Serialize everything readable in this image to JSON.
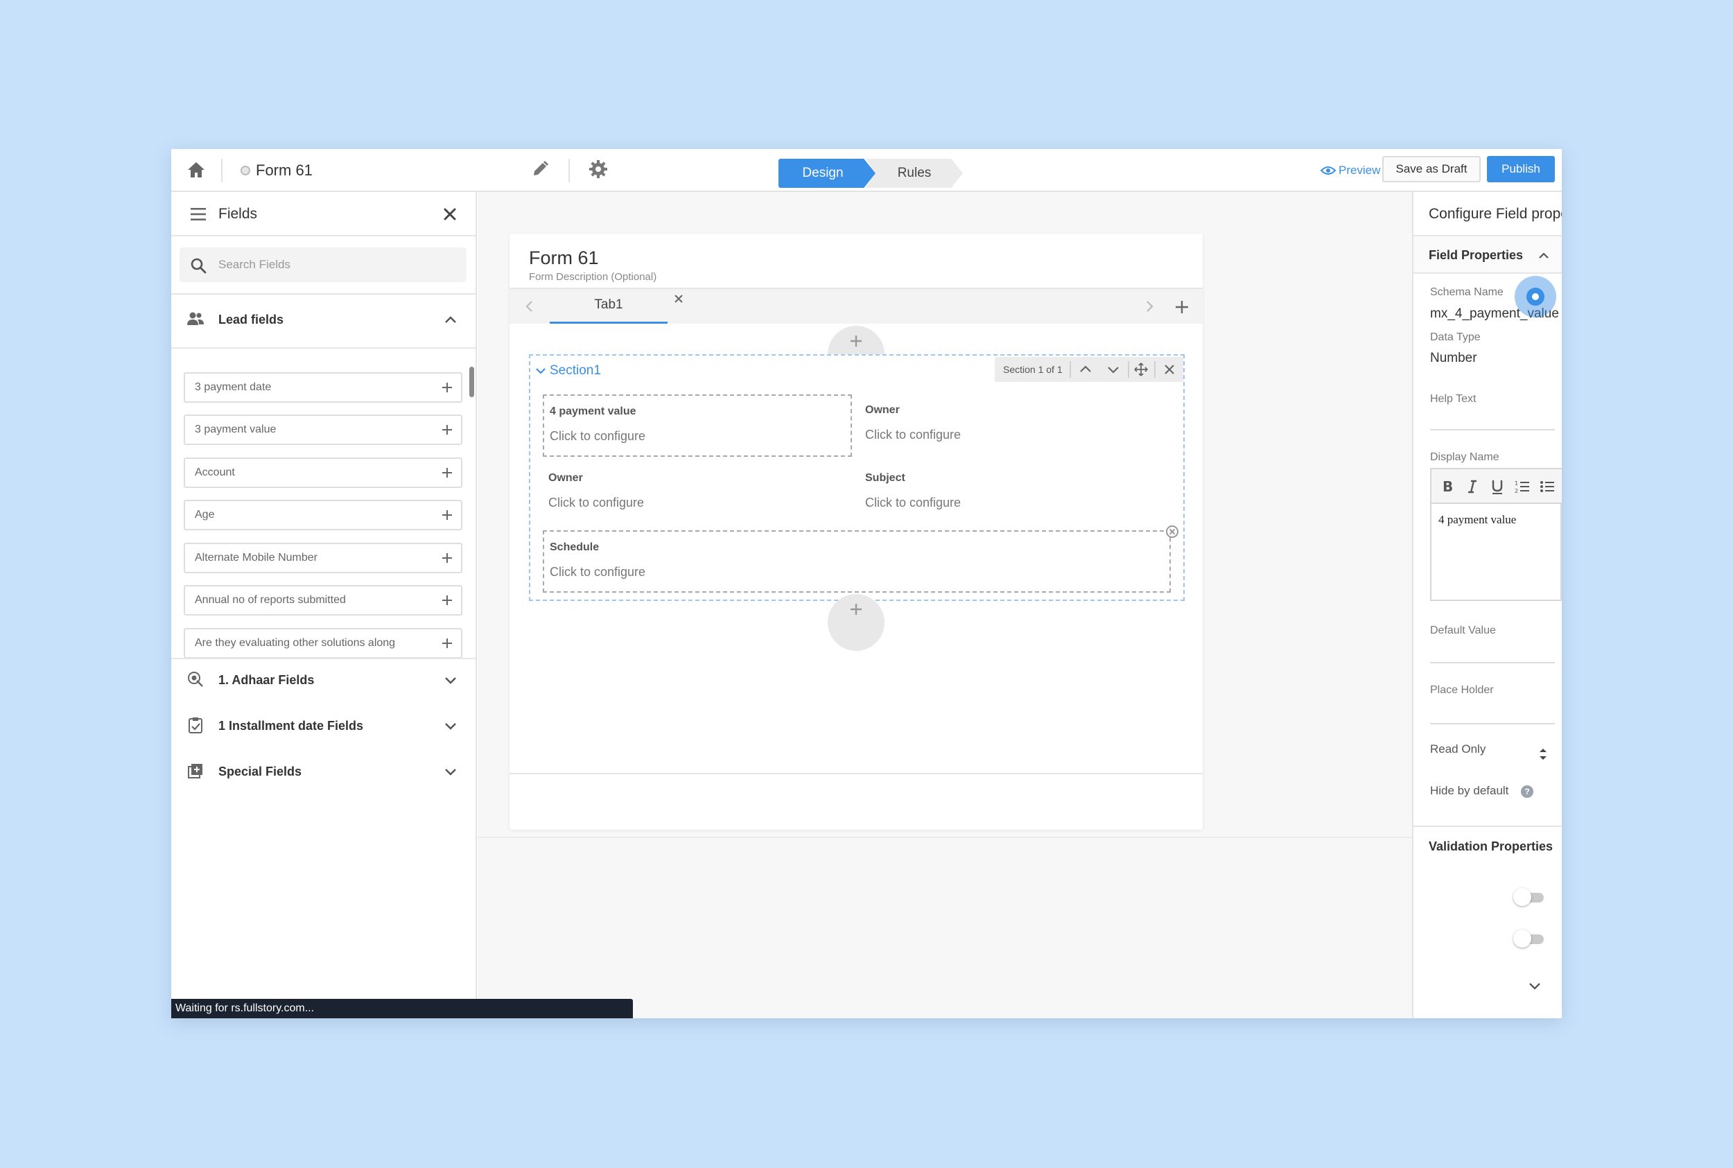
{
  "topbar": {
    "form_name": "Form 61",
    "steps": {
      "design": "Design",
      "rules": "Rules"
    },
    "preview": "Preview",
    "save_draft": "Save as Draft",
    "publish": "Publish"
  },
  "left_panel": {
    "title": "Fields",
    "search_placeholder": "Search Fields",
    "lead_group": "Lead fields",
    "fields": [
      "3 payment date",
      "3 payment value",
      "Account",
      "Age",
      "Alternate Mobile Number",
      "Annual no of reports submitted",
      "Are they evaluating other solutions along"
    ],
    "groups": [
      "1. Adhaar Fields",
      "1 Installment date Fields",
      "Special Fields"
    ],
    "status": "Waiting for rs.fullstory.com..."
  },
  "canvas": {
    "form_title": "Form 61",
    "form_description": "Form Description (Optional)",
    "tab": "Tab1",
    "section": {
      "title": "Section1",
      "position": "Section 1 of 1",
      "cells": [
        {
          "label": "4 payment value",
          "hint": "Click to configure"
        },
        {
          "label": "Owner",
          "hint": "Click to configure"
        },
        {
          "label": "Owner",
          "hint": "Click to configure"
        },
        {
          "label": "Subject",
          "hint": "Click to configure"
        },
        {
          "label": "Schedule",
          "hint": "Click to configure"
        }
      ]
    }
  },
  "right_panel": {
    "title": "Configure Field properties",
    "field_properties": "Field Properties",
    "schema_name_label": "Schema Name",
    "schema_name": "mx_4_payment_value",
    "data_type_label": "Data Type",
    "data_type": "Number",
    "help_text_label": "Help Text",
    "help_text": "",
    "display_name_label": "Display Name",
    "display_name": "4 payment value",
    "default_value_label": "Default Value",
    "default_value": "",
    "placeholder_label": "Place Holder",
    "placeholder": "",
    "read_only_label": "Read Only",
    "read_only": false,
    "hide_by_default_label": "Hide by default",
    "hide_by_default": false,
    "validation_properties": "Validation Properties"
  },
  "colors": {
    "accent": "#3a8fe6",
    "page_bg": "#c7e1fb",
    "status_bar": "#1b2330"
  }
}
